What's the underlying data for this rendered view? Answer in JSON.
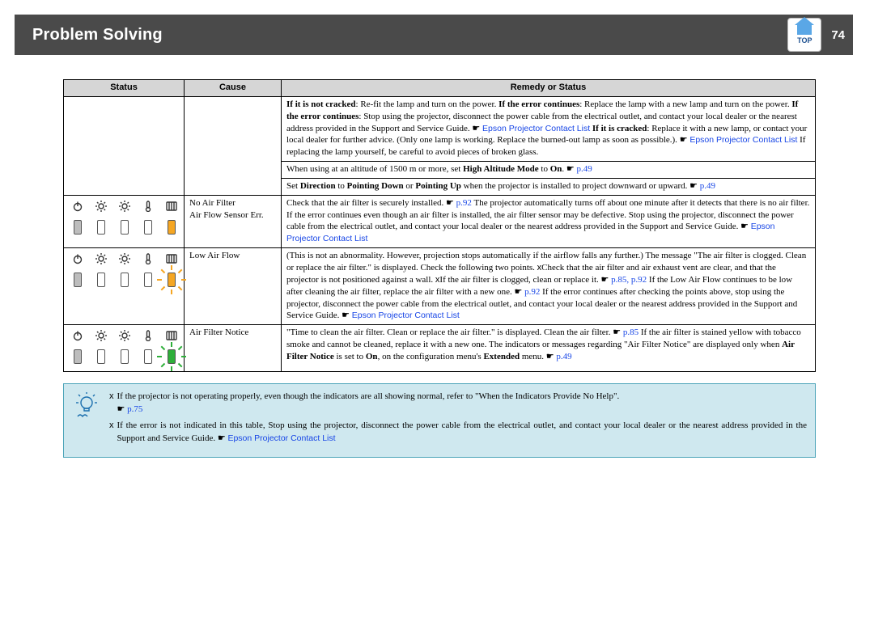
{
  "header": {
    "title": "Problem Solving",
    "top_label": "TOP",
    "page_number": "74"
  },
  "table": {
    "headers": {
      "status": "Status",
      "cause": "Cause",
      "remedy": "Remedy or Status"
    }
  },
  "links": {
    "contact": "Epson Projector Contact List",
    "p49": "p.49",
    "p75": "p.75",
    "p85": "p.85",
    "p92": "p.92",
    "p85p92": "p.85, p.92"
  },
  "rows": {
    "r1": {
      "a": "If it is not cracked",
      "a2": ": Re-fit the lamp and turn on the power.",
      "b": "If the error continues",
      "b2": ": Replace the lamp with a new lamp and turn on the power.",
      "c": "If the error continues",
      "c2": ": Stop using the projector, disconnect the power cable from the electrical outlet, and contact your local dealer or the nearest address provided in the Support and Service Guide. ",
      "d": "If it is cracked",
      "d2": ": Replace it with a new lamp, or contact your local dealer for further advice. (Only one lamp is working. Replace the burned-out lamp as soon as possible.). ",
      "e": "If replacing the lamp yourself, be careful to avoid pieces of broken glass."
    },
    "r2": {
      "a1": "When using at an altitude of 1500 m or more, set ",
      "a2": "High Altitude Mode",
      "a3": " to ",
      "a4": "On",
      "a5": ". "
    },
    "r3": {
      "a1": "Set ",
      "a2": "Direction",
      "a3": " to ",
      "a4": "Pointing Down",
      "a5": " or ",
      "a6": "Pointing Up",
      "a7": " when the projector is installed to project downward or upward. "
    },
    "r4": {
      "cause1": "No Air Filter",
      "cause2": "Air Flow Sensor Err.",
      "a": "Check that the air filter is securely installed. ",
      "b": "The projector automatically turns off about one minute after it detects that there is no air filter.",
      "c": "If the error continues even though an air filter is installed, the air filter sensor may be defective. Stop using the projector, disconnect the power cable from the electrical outlet, and contact your local dealer or the nearest address provided in the Support and Service Guide. "
    },
    "r5": {
      "cause": "Low Air Flow",
      "a": "(This is not an abnormality. However, projection stops automatically if the airflow falls any further.)",
      "b": "The message \"The air filter is clogged. Clean or replace the air filter.\" is displayed. Check the following two points.",
      "c": "Check that the air filter and air exhaust vent are clear, and that the projector is not positioned against a wall.",
      "d": "If the air filter is clogged, clean or replace it. ",
      "e": "If the Low Air Flow continues to be low after cleaning the air filter, replace the air filter with a new one. ",
      "f": "If the error continues after checking the points above, stop using the projector, disconnect the power cable from the electrical outlet, and contact your local dealer or the nearest address provided in the Support and Service Guide."
    },
    "r6": {
      "cause": "Air Filter Notice",
      "a": "\"Time to clean the air filter. Clean or replace the air filter.\" is displayed. Clean the air filter. ",
      "b": "If the air filter is stained yellow with tobacco smoke and cannot be cleaned, replace it with a new one.",
      "c1": "The indicators or messages regarding \"Air Filter Notice\" are displayed only when ",
      "c2": "Air Filter Notice",
      "c3": " is set to ",
      "c4": "On",
      "c5": ", on the configuration menu's ",
      "c6": "Extended",
      "c7": " menu. "
    }
  },
  "tip": {
    "t1a": "If the projector is not operating properly, even though the indicators are all showing normal, refer to \"When the Indicators Provide No Help\".",
    "t2a": "If the error is not indicated in this table, Stop using the projector, disconnect the power cable from the electrical outlet, and contact your local dealer or the nearest address provided in the Support and Service Guide. "
  },
  "bullet": "x",
  "pointer": "☛"
}
